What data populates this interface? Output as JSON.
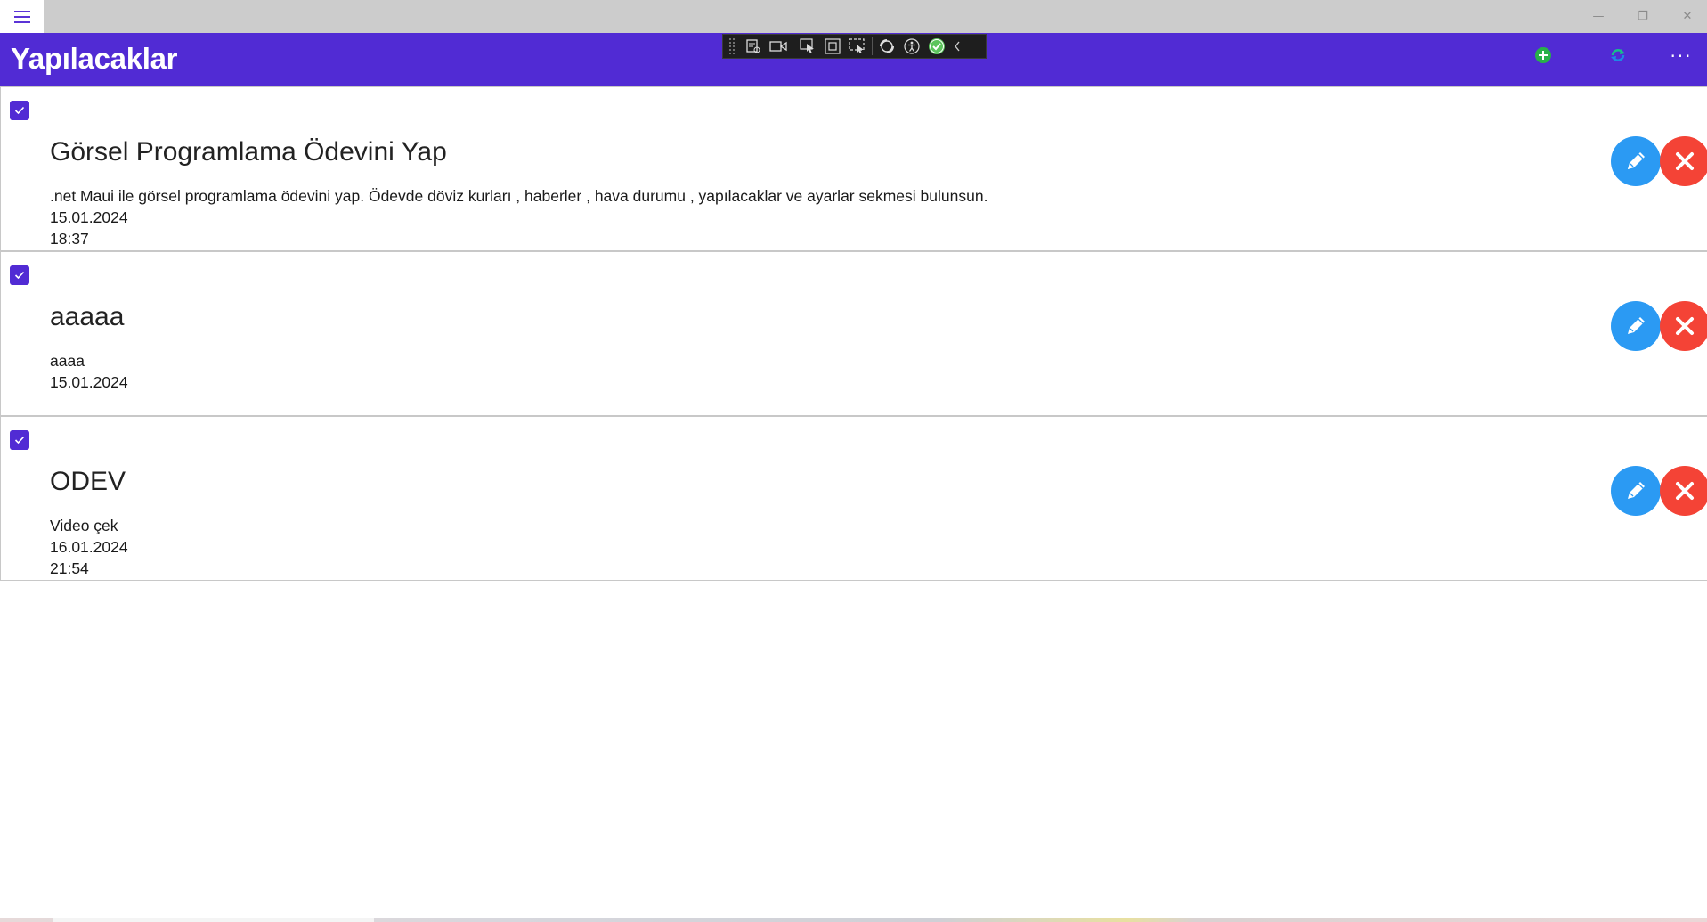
{
  "window": {
    "minimize_glyph": "—",
    "restore_glyph": "❐",
    "close_glyph": "✕"
  },
  "header": {
    "title": "Yapılacaklar",
    "more_glyph": "···",
    "add_icon": "plus-circle-icon",
    "refresh_icon": "refresh-icon"
  },
  "debug_toolbar": {
    "icons": [
      "live-visual-tree-icon",
      "record-icon",
      "select-element-icon",
      "display-layout-adorners-icon",
      "track-focus-icon",
      "hot-reload-icon",
      "accessibility-icon",
      "binding-ok-icon",
      "collapse-chevron-icon"
    ]
  },
  "colors": {
    "accent": "#512bd4",
    "edit": "#2b9af3",
    "delete": "#f44336"
  },
  "tasks": [
    {
      "checked": true,
      "title": "Görsel Programlama Ödevini Yap",
      "description": ".net Maui ile görsel programlama ödevini yap. Ödevde döviz kurları , haberler , hava durumu , yapılacaklar ve ayarlar sekmesi bulunsun.",
      "date": "15.01.2024",
      "time": "18:37"
    },
    {
      "checked": true,
      "title": "aaaaa",
      "description": "aaaa",
      "date": "15.01.2024",
      "time": ""
    },
    {
      "checked": true,
      "title": "ODEV",
      "description": "Video çek",
      "date": "16.01.2024",
      "time": "21:54"
    }
  ]
}
